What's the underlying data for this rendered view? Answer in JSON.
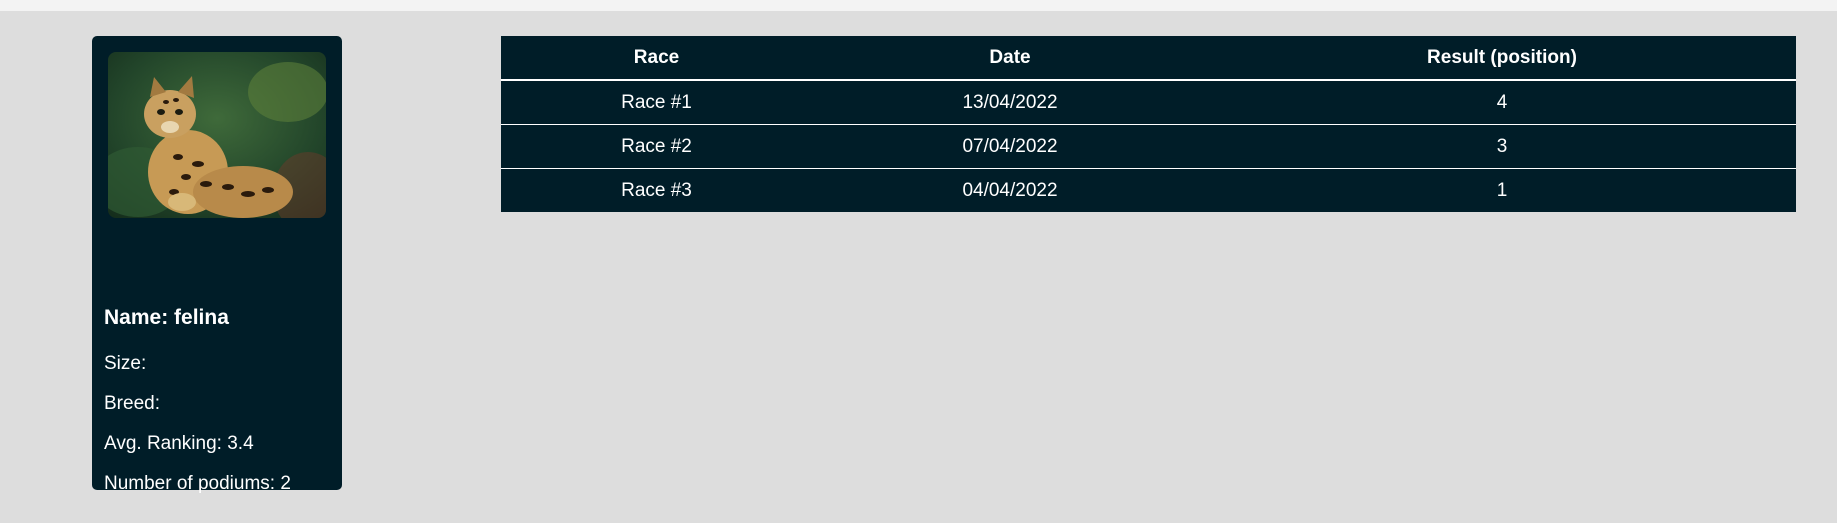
{
  "profile": {
    "photo_icon": "ocelot-photo",
    "name": "Name: felina",
    "size": "Size:",
    "breed": "Breed:",
    "avg_ranking": "Avg. Ranking: 3.4",
    "podiums": "Number of podiums: 2"
  },
  "table": {
    "headers": [
      "Race",
      "Date",
      "Result (position)"
    ],
    "rows": [
      [
        "Race #1",
        "13/04/2022",
        "4"
      ],
      [
        "Race #2",
        "07/04/2022",
        "3"
      ],
      [
        "Race #3",
        "04/04/2022",
        "1"
      ]
    ]
  },
  "colors": {
    "background": "#dddddd",
    "panel": "#001d28",
    "text": "#ffffff"
  }
}
